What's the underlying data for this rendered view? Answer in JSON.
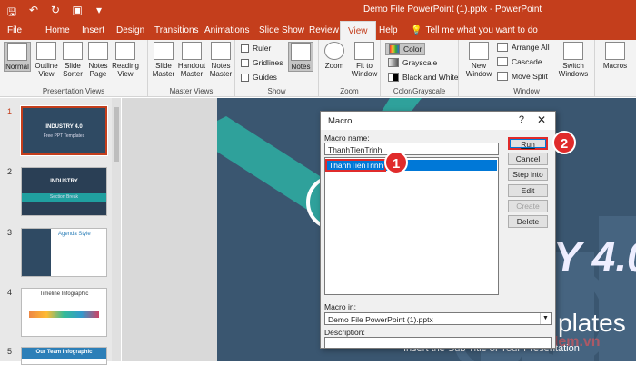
{
  "window": {
    "title": "Demo File PowerPoint (1).pptx  -  PowerPoint"
  },
  "tabs": [
    {
      "label": "File"
    },
    {
      "label": "Home"
    },
    {
      "label": "Insert"
    },
    {
      "label": "Design"
    },
    {
      "label": "Transitions"
    },
    {
      "label": "Animations"
    },
    {
      "label": "Slide Show"
    },
    {
      "label": "Review"
    },
    {
      "label": "View"
    },
    {
      "label": "Help"
    }
  ],
  "tell_me": "Tell me what you want to do",
  "ribbon": {
    "presentation_views": {
      "label": "Presentation Views",
      "buttons": [
        {
          "label": "Normal"
        },
        {
          "label": "Outline View"
        },
        {
          "label": "Slide Sorter"
        },
        {
          "label": "Notes Page"
        },
        {
          "label": "Reading View"
        }
      ]
    },
    "master_views": {
      "label": "Master Views",
      "buttons": [
        {
          "label": "Slide Master"
        },
        {
          "label": "Handout Master"
        },
        {
          "label": "Notes Master"
        }
      ]
    },
    "show": {
      "label": "Show",
      "checks": [
        {
          "label": "Ruler"
        },
        {
          "label": "Gridlines"
        },
        {
          "label": "Guides"
        }
      ],
      "notes": "Notes"
    },
    "zoom": {
      "label": "Zoom",
      "buttons": [
        {
          "label": "Zoom"
        },
        {
          "label": "Fit to Window"
        }
      ]
    },
    "color": {
      "label": "Color/Grayscale",
      "items": [
        {
          "label": "Color"
        },
        {
          "label": "Grayscale"
        },
        {
          "label": "Black and White"
        }
      ]
    },
    "window": {
      "label": "Window",
      "new_window": "New Window",
      "items": [
        {
          "label": "Arrange All"
        },
        {
          "label": "Cascade"
        },
        {
          "label": "Move Split"
        }
      ],
      "switch": "Switch Windows"
    },
    "macros": {
      "label": "Macros"
    }
  },
  "thumbnails": [
    {
      "num": "1",
      "title": "INDUSTRY 4.0",
      "sub": "Free PPT Templates"
    },
    {
      "num": "2",
      "title": "INDUSTRY",
      "sub": "Section Break"
    },
    {
      "num": "3",
      "title": "Agenda Style",
      "sub": ""
    },
    {
      "num": "4",
      "title": "Timeline Infographic",
      "sub": ""
    },
    {
      "num": "5",
      "title": "Our Team Infographic",
      "sub": ""
    }
  ],
  "slide": {
    "big_text": "Y 4.0",
    "templates_text": "plates",
    "subtitle": "Insert the Sub Title of Your Presentation",
    "watermark": "ThuThuatPhanMem.vn"
  },
  "dialog": {
    "title": "Macro",
    "help": "?",
    "close": "✕",
    "name_label": "Macro name:",
    "name_value": "ThanhTienTrinh",
    "list_item": "ThanhTienTrinh",
    "buttons": {
      "run": "Run",
      "cancel": "Cancel",
      "step_into": "Step into",
      "edit": "Edit",
      "create": "Create",
      "delete": "Delete"
    },
    "macro_in_label": "Macro in:",
    "macro_in_value": "Demo File PowerPoint (1).pptx",
    "description_label": "Description:"
  },
  "callouts": {
    "one": "1",
    "two": "2"
  }
}
